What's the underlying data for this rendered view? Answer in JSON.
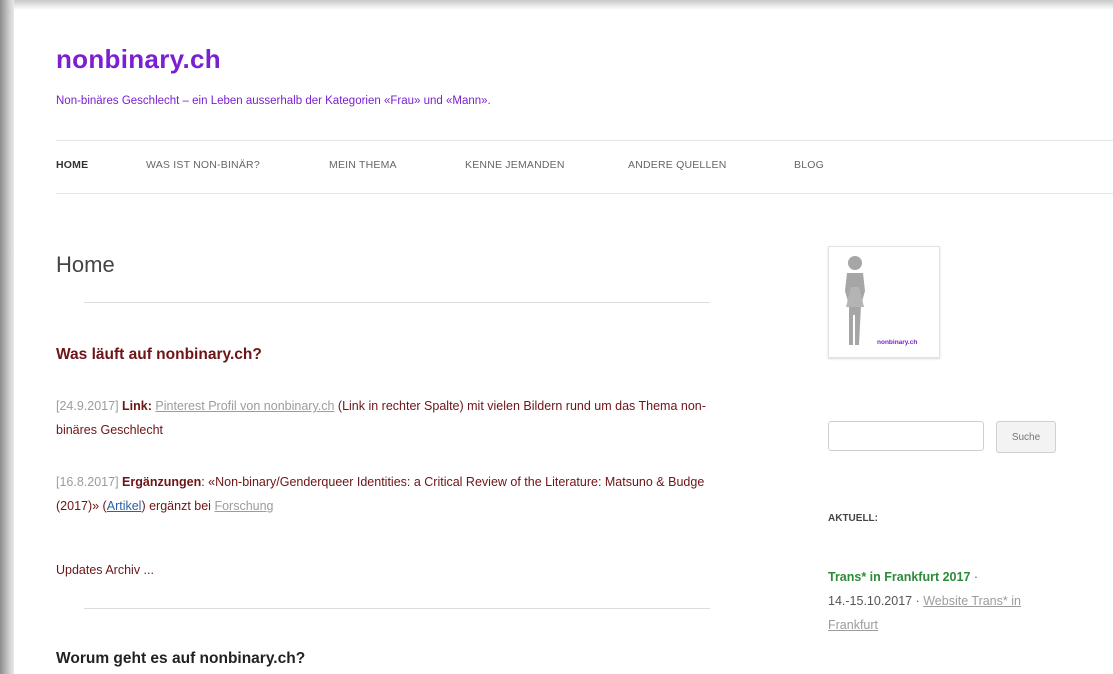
{
  "site": {
    "title": "nonbinary.ch",
    "description": "Non-binäres Geschlecht – ein Leben ausserhalb der Kategorien «Frau» und «Mann»."
  },
  "nav": {
    "items": [
      {
        "label": "HOME",
        "active": true
      },
      {
        "label": "WAS IST NON-BINÄR?"
      },
      {
        "label": "MEIN THEMA"
      },
      {
        "label": "KENNE JEMANDEN"
      },
      {
        "label": "ANDERE QUELLEN"
      },
      {
        "label": "BLOG"
      }
    ]
  },
  "main": {
    "page_title": "Home",
    "section1_heading": "Was läuft auf nonbinary.ch?",
    "updates": [
      {
        "date": "[24.9.2017]",
        "label": "Link",
        "link_text": "Pinterest Profil von nonbinary.ch",
        "text_after": " (Link in rechter Spalte) mit vielen Bildern rund um das Thema non-binäres Geschlecht"
      },
      {
        "date": "[16.8.2017]",
        "label": "Ergänzungen",
        "text": ": «Non-binary/Genderqueer Identities: a Critical Review of the Literature: Matsuno & Budge (2017)» (",
        "link1_text": "Artikel",
        "text_mid": ") ergänzt bei ",
        "link2_text": "Forschung"
      }
    ],
    "archive_link": "Updates Archiv ...",
    "section2_heading": "Worum geht es auf nonbinary.ch?"
  },
  "sidebar": {
    "logo_text": "nonbinary.ch",
    "search": {
      "placeholder": "",
      "button_label": "Suche"
    },
    "widget_title": "AKTUELL:",
    "event_title": "Trans* in Frankfurt 2017",
    "event_sep": " · ",
    "event_dates": "14.-15.10.2017 · ",
    "event_link": "Website Trans* in Frankfurt"
  },
  "colors": {
    "brand": "#7a1fd1",
    "heading": "#6e1416",
    "event": "#2d8a3a"
  }
}
